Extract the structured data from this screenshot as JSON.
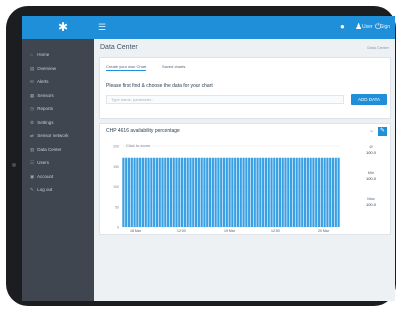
{
  "topbar": {
    "logo_glyph": "✱",
    "menu_glyph": "☰",
    "icons": [
      "bell-icon",
      "user-icon",
      "logout-icon"
    ],
    "user_text": "User",
    "logout_text": "Sign out"
  },
  "sidebar": {
    "items": [
      {
        "icon": "⌂",
        "label": "Home"
      },
      {
        "icon": "▤",
        "label": "Overview"
      },
      {
        "icon": "✉",
        "label": "Alerts"
      },
      {
        "icon": "▦",
        "label": "Sensors"
      },
      {
        "icon": "◷",
        "label": "Reports"
      },
      {
        "icon": "⚙",
        "label": "Settings"
      },
      {
        "icon": "⇄",
        "label": "Sensor network"
      },
      {
        "icon": "▥",
        "label": "Data Center"
      },
      {
        "icon": "☷",
        "label": "Users"
      },
      {
        "icon": "▣",
        "label": "Account"
      },
      {
        "icon": "✎",
        "label": "Log out"
      }
    ]
  },
  "main": {
    "title": "Data Center",
    "breadcrumb": "Data Center"
  },
  "filter_card": {
    "tabs": [
      "Create your own Chart",
      "Saved charts"
    ],
    "prompt": "Please first find & choose the data for your chart",
    "input_placeholder": "Type name, parameter...",
    "button_label": "ADD DATA"
  },
  "chart_card": {
    "title": "CHP 4616 availability percentage",
    "zoom_label": "Click to zoom",
    "stats": [
      {
        "label": "Ø",
        "value": "100.0"
      },
      {
        "label": "Min",
        "value": "100.0"
      },
      {
        "label": "Max",
        "value": "100.0"
      }
    ]
  },
  "chart_data": {
    "type": "bar",
    "ylim": [
      0,
      200
    ],
    "yticks": [
      "0",
      "25",
      "50",
      "75",
      "100",
      "125",
      "150",
      "175",
      "200"
    ],
    "xticks": [
      "18 Mar",
      "12:00",
      "19 Mar",
      "12:00",
      "20 Mar"
    ],
    "value": 171,
    "bar_count": 78,
    "bar_color": "#3aa0e4",
    "grid": true
  },
  "colors": {
    "accent": "#1e8fd8",
    "sidebar": "#3f4650"
  }
}
